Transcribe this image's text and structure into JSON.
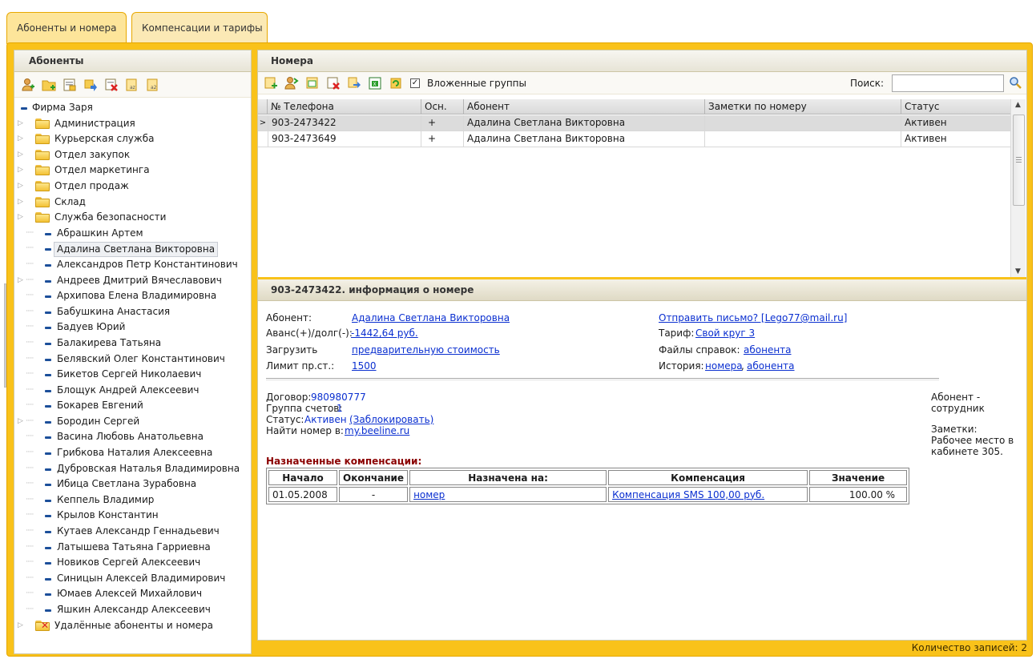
{
  "tabs": [
    {
      "label": "Абоненты и номера",
      "active": true
    },
    {
      "label": "Компенсации и тарифы",
      "active": false
    }
  ],
  "left_panel": {
    "title": "Абоненты",
    "toolbar_icons": [
      "add-user-icon",
      "add-folder-icon",
      "edit-icon",
      "move-icon",
      "delete-icon",
      "sort-az-icon",
      "sort-za-icon"
    ],
    "root": "Фирма Заря",
    "groups": [
      "Администрация",
      "Курьерская служба",
      "Отдел закупок",
      "Отдел маркетинга",
      "Отдел продаж",
      "Склад",
      "Служба безопасности"
    ],
    "people": [
      "Абрашкин Артем",
      "Адалина Светлана Викторовна",
      "Александров Петр Константинович",
      "Андреев Дмитрий Вячеславович",
      "Архипова Елена Владимировна",
      "Бабушкина Анастасия",
      "Бадуев Юрий",
      "Балакирева Татьяна",
      "Белявский Олег Константинович",
      "Бикетов Сергей Николаевич",
      "Блощук Андрей Алексеевич",
      "Бокарев Евгений",
      "Бородин Сергей",
      "Васина Любовь Анатольевна",
      "Грибкова Наталия Алексеевна",
      "Дубровская Наталья Владимировна",
      "Ибица Светлана Зурабовна",
      "Кеппель Владимир",
      "Крылов Константин",
      "Кутаев Александр Геннадьевич",
      "Латышева Татьяна Гарриевна",
      "Новиков Сергей Алексеевич",
      "Синицын Алексей Владимирович",
      "Юмаев Алексей Михайлович",
      "Яшкин Александр Алексеевич"
    ],
    "selected_person": "Адалина Светлана Викторовна",
    "deleted": "Удалённые абоненты и номера"
  },
  "numbers_panel": {
    "title": "Номера",
    "nested_groups_label": "Вложенные группы",
    "nested_groups_checked": true,
    "search_label": "Поиск:",
    "search_value": "",
    "columns": [
      "№ Телефона",
      "Осн.",
      "Абонент",
      "Заметки по номеру",
      "Статус"
    ],
    "rows": [
      {
        "phone": "903-2473422",
        "main": "+",
        "subscriber": "Адалина Светлана Викторовна",
        "notes": "",
        "status": "Активен",
        "selected": true
      },
      {
        "phone": "903-2473649",
        "main": "+",
        "subscriber": "Адалина Светлана Викторовна",
        "notes": "",
        "status": "Активен",
        "selected": false
      }
    ]
  },
  "info": {
    "header": "903-2473422. информация о номере",
    "subscriber_label": "Абонент:",
    "subscriber_value": "Адалина Светлана Викторовна",
    "balance_label": "Аванс(+)/долг(-):",
    "balance_value": "-1442,64 руб.",
    "load_label": "Загрузить",
    "load_value": "предварительную стоимость",
    "limit_label": "Лимит пр.ст.:",
    "limit_value": "1500",
    "send_letter": "Отправить письмо? [Lego77@mail.ru]",
    "tariff_label": "Тариф:",
    "tariff_value": "Свой круг 3",
    "files_label": "Файлы справок:",
    "files_value": "абонента",
    "history_label": "История:",
    "history_number": "номера",
    "history_sep": ",",
    "history_subscriber": "абонента",
    "contract_label": "Договор:",
    "contract_value": "980980777",
    "group_label": "Группа счетов:",
    "group_value": "1",
    "status_label": "Статус:",
    "status_value": "Активен",
    "block_link": "(Заблокировать)",
    "find_label": "Найти номер в:",
    "find_value": "my.beeline.ru",
    "side_employee": "Абонент - сотрудник",
    "side_notes_label": "Заметки:",
    "side_notes_value": "Рабочее место в кабинете 305."
  },
  "compensations": {
    "title": "Назначенные компенсации:",
    "columns": [
      "Начало",
      "Окончание",
      "Назначена на:",
      "Компенсация",
      "Значение"
    ],
    "rows": [
      {
        "start": "01.05.2008",
        "end": "-",
        "assigned_to": "номер",
        "compensation": "Компенсация SMS 100,00 руб.",
        "value": "100.00 %"
      }
    ]
  },
  "status_bar": "Количество записей: 2",
  "colors": {
    "accent": "#f9c21a",
    "link": "#0a2fd0",
    "comp_title": "#8b0000"
  }
}
